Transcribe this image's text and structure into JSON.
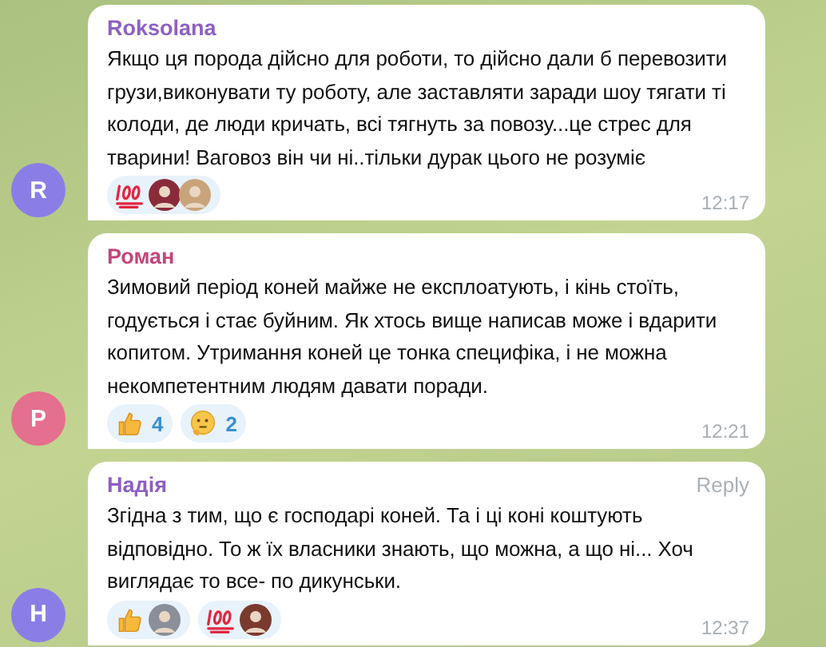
{
  "messages": [
    {
      "author": "Roksolana",
      "color": "#8e5fc4",
      "avatar": {
        "letter": "R",
        "color": "#8a7ee6"
      },
      "text": "Якщо ця порода дійсно для роботи, то дійсно дали б перевозити грузи,виконувати ту роботу, але заставляти заради шоу тягати ті колоди, де люди кричать, всі тягнуть за повозу...це стрес для тварини! Ваговоз він чи ні..тільки дурак цього не розуміє",
      "time": "12:17",
      "reactions": [
        {
          "kind": "hundred",
          "reactors": [
            {
              "color": "#8a2b3a"
            },
            {
              "color": "#c9a47a"
            }
          ]
        }
      ]
    },
    {
      "author": "Роман",
      "color": "#c2477a",
      "avatar": {
        "letter": "Р",
        "color": "#e56f8e"
      },
      "text": "Зимовий період коней майже не експлоатують, і кінь стоїть, годується і стає буйним. Як хтось вище написав може і вдарити копитом. Утримання коней це тонка специфіка, і не можна некомпетентним людям давати поради.",
      "time": "12:21",
      "reactions": [
        {
          "kind": "thumbs",
          "count": "4"
        },
        {
          "kind": "thinking",
          "count": "2"
        }
      ]
    },
    {
      "author": "Надія",
      "color": "#8e5fc4",
      "avatar": {
        "letter": "Н",
        "color": "#8a7ee6"
      },
      "reply_label": "Reply",
      "text": "Згідна з тим, що є господарі коней. Та і ці коні коштують відповідно. То ж їх власники знають, що можна, а що ні... Хоч виглядає то все- по дикунськи.",
      "time": "12:37",
      "reactions": [
        {
          "kind": "thumbs",
          "reactors": [
            {
              "color": "#8a8f9a"
            }
          ]
        },
        {
          "kind": "hundred",
          "reactors": [
            {
              "color": "#7a3a2e"
            }
          ]
        }
      ]
    }
  ]
}
